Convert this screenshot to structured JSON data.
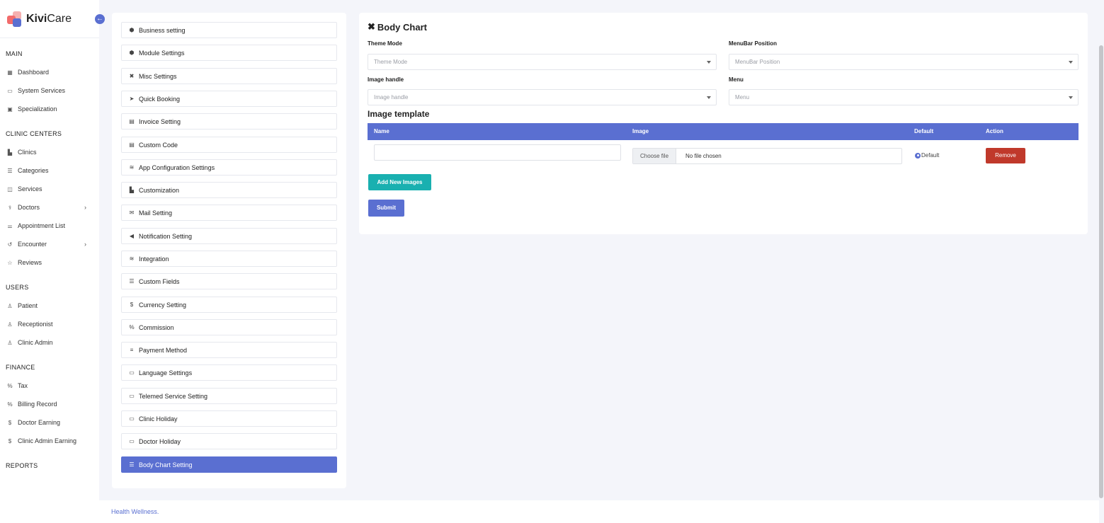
{
  "brand": {
    "name_bold": "Kivi",
    "name_rest": "Care"
  },
  "sidebar": {
    "sections": [
      {
        "title": "MAIN",
        "items": [
          {
            "label": "Dashboard",
            "icon": "grid-icon",
            "glyph": "▦"
          },
          {
            "label": "System Services",
            "icon": "monitor-icon",
            "glyph": "▭"
          },
          {
            "label": "Specialization",
            "icon": "building-icon",
            "glyph": "▣"
          }
        ]
      },
      {
        "title": "CLINIC CENTERS",
        "items": [
          {
            "label": "Clinics",
            "icon": "hospital-icon",
            "glyph": "▙"
          },
          {
            "label": "Categories",
            "icon": "list-icon",
            "glyph": "☰"
          },
          {
            "label": "Services",
            "icon": "briefcase-icon",
            "glyph": "◫"
          },
          {
            "label": "Doctors",
            "icon": "stethoscope-icon",
            "glyph": "⚕",
            "chevron": true
          },
          {
            "label": "Appointment List",
            "icon": "sliders-icon",
            "glyph": "⚌"
          },
          {
            "label": "Encounter",
            "icon": "history-icon",
            "glyph": "↺",
            "chevron": true
          },
          {
            "label": "Reviews",
            "icon": "star-icon",
            "glyph": "☆"
          }
        ]
      },
      {
        "title": "USERS",
        "items": [
          {
            "label": "Patient",
            "icon": "user-icon",
            "glyph": "♙"
          },
          {
            "label": "Receptionist",
            "icon": "user-icon",
            "glyph": "♙"
          },
          {
            "label": "Clinic Admin",
            "icon": "user-icon",
            "glyph": "♙"
          }
        ]
      },
      {
        "title": "FINANCE",
        "items": [
          {
            "label": "Tax",
            "icon": "percent-icon",
            "glyph": "%"
          },
          {
            "label": "Billing Record",
            "icon": "percent-icon",
            "glyph": "%"
          },
          {
            "label": "Doctor Earning",
            "icon": "dollar-icon",
            "glyph": "$"
          },
          {
            "label": "Clinic Admin Earning",
            "icon": "dollar-icon",
            "glyph": "$"
          }
        ]
      },
      {
        "title": "REPORTS",
        "items": []
      }
    ]
  },
  "settings_menu": {
    "items": [
      {
        "label": "Business setting",
        "icon": "cube-icon",
        "glyph": "⬢"
      },
      {
        "label": "Module Settings",
        "icon": "cube-icon",
        "glyph": "⬢"
      },
      {
        "label": "Misc Settings",
        "icon": "tools-icon",
        "glyph": "✖"
      },
      {
        "label": "Quick Booking",
        "icon": "paper-plane-icon",
        "glyph": "➤"
      },
      {
        "label": "Invoice Setting",
        "icon": "file-icon",
        "glyph": "▤"
      },
      {
        "label": "Custom Code",
        "icon": "file-code-icon",
        "glyph": "▤"
      },
      {
        "label": "App Configuration Settings",
        "icon": "sliders-icon",
        "glyph": "≋"
      },
      {
        "label": "Customization",
        "icon": "chart-icon",
        "glyph": "▙"
      },
      {
        "label": "Mail Setting",
        "icon": "envelope-icon",
        "glyph": "✉"
      },
      {
        "label": "Notification Setting",
        "icon": "bullhorn-icon",
        "glyph": "◀"
      },
      {
        "label": "Integration",
        "icon": "sliders-icon",
        "glyph": "≋"
      },
      {
        "label": "Custom Fields",
        "icon": "bars-icon",
        "glyph": "☰"
      },
      {
        "label": "Currency Setting",
        "icon": "dollar-icon",
        "glyph": "$"
      },
      {
        "label": "Commission",
        "icon": "percent-icon",
        "glyph": "%"
      },
      {
        "label": "Payment Method",
        "icon": "money-icon",
        "glyph": "≡"
      },
      {
        "label": "Language Settings",
        "icon": "id-card-icon",
        "glyph": "▭"
      },
      {
        "label": "Telemed Service Setting",
        "icon": "id-card-icon",
        "glyph": "▭"
      },
      {
        "label": "Clinic Holiday",
        "icon": "id-card-icon",
        "glyph": "▭"
      },
      {
        "label": "Doctor Holiday",
        "icon": "id-card-icon",
        "glyph": "▭"
      },
      {
        "label": "Body Chart Setting",
        "icon": "bars-icon",
        "glyph": "☰",
        "active": true
      }
    ]
  },
  "body_chart": {
    "title": "Body Chart",
    "fields": {
      "theme_mode": {
        "label": "Theme Mode",
        "placeholder": "Theme Mode"
      },
      "menubar_position": {
        "label": "MenuBar Position",
        "placeholder": "MenuBar Position"
      },
      "image_handle": {
        "label": "Image handle",
        "placeholder": "Image handle"
      },
      "menu": {
        "label": "Menu",
        "placeholder": "Menu"
      }
    },
    "image_template": {
      "title": "Image template",
      "columns": [
        "Name",
        "Image",
        "Default",
        "Action"
      ],
      "row": {
        "name_value": "",
        "choose_file_label": "Choose file",
        "file_status": "No file chosen",
        "default_label": "Default",
        "remove_label": "Remove"
      }
    },
    "add_button_label": "Add New Images",
    "submit_label": "Submit"
  },
  "footer": {
    "text": "Health Wellness."
  },
  "colors": {
    "primary": "#5a6fd1",
    "teal": "#19b0b0",
    "danger": "#c0392b",
    "background": "#f4f5fa"
  }
}
